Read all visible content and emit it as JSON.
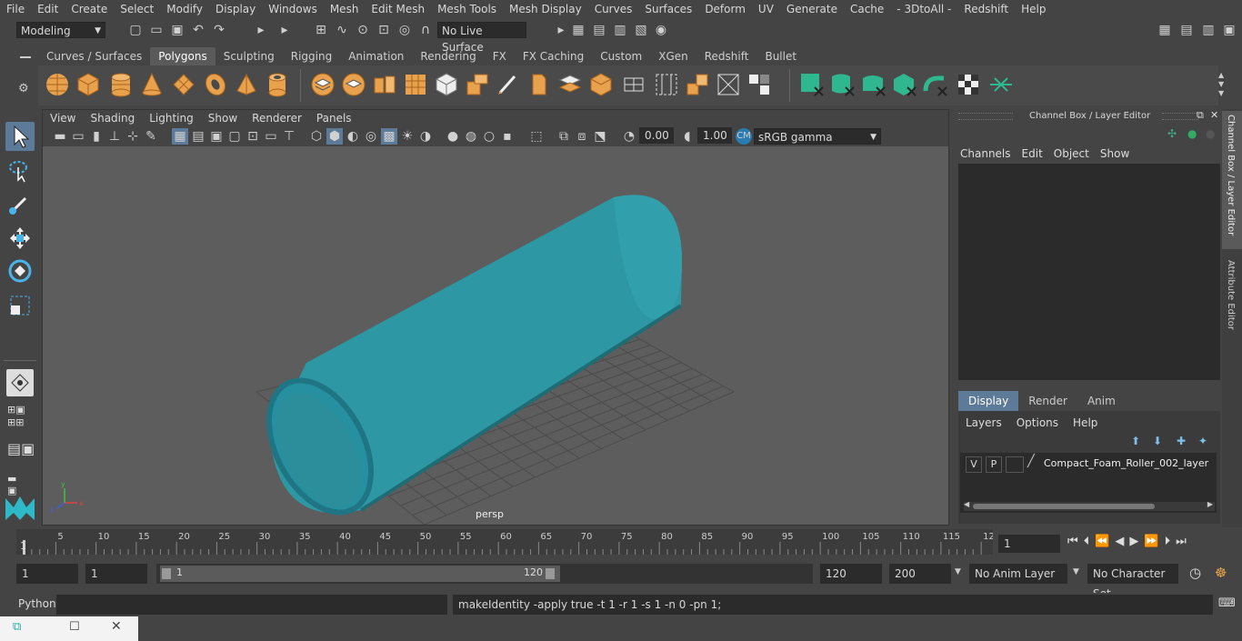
{
  "menubar": [
    "File",
    "Edit",
    "Create",
    "Select",
    "Modify",
    "Display",
    "Windows",
    "Mesh",
    "Edit Mesh",
    "Mesh Tools",
    "Mesh Display",
    "Curves",
    "Surfaces",
    "Deform",
    "UV",
    "Generate",
    "Cache",
    "- 3DtoAll -",
    "Redshift",
    "Help"
  ],
  "status": {
    "mode": "Modeling",
    "live_surface": "No Live Surface"
  },
  "shelf_tabs": [
    "Curves / Surfaces",
    "Polygons",
    "Sculpting",
    "Rigging",
    "Animation",
    "Rendering",
    "FX",
    "FX Caching",
    "Custom",
    "XGen",
    "Redshift",
    "Bullet"
  ],
  "active_shelf_tab": "Polygons",
  "viewport": {
    "menu": [
      "View",
      "Shading",
      "Lighting",
      "Show",
      "Renderer",
      "Panels"
    ],
    "exposure": "0.00",
    "gamma": "1.00",
    "color_space": "sRGB gamma",
    "camera_label": "persp",
    "object_color": "#2f9aa6"
  },
  "channel_box": {
    "title": "Channel Box / Layer Editor",
    "menu": [
      "Channels",
      "Edit",
      "Object",
      "Show"
    ],
    "layer_tabs": [
      "Display",
      "Render",
      "Anim"
    ],
    "active_layer_tab": "Display",
    "layer_menu": [
      "Layers",
      "Options",
      "Help"
    ],
    "layer": {
      "v": "V",
      "p": "P",
      "name": "Compact_Foam_Roller_002_layer"
    }
  },
  "side_tabs": [
    "Channel Box / Layer Editor",
    "Attribute Editor"
  ],
  "time_slider": {
    "ticks": [
      "5",
      "10",
      "15",
      "20",
      "25",
      "30",
      "35",
      "40",
      "45",
      "50",
      "55",
      "60",
      "65",
      "70",
      "75",
      "80",
      "85",
      "90",
      "95",
      "100",
      "105",
      "110",
      "115",
      "12"
    ],
    "start": "1",
    "current_frame": "1"
  },
  "range": {
    "start": "1",
    "playback_start": "1",
    "slider_start": "1",
    "slider_end": "120",
    "end": "120",
    "anim_end": "200",
    "anim_layer": "No Anim Layer",
    "character_set": "No Character Set"
  },
  "command": {
    "lang": "Python",
    "result": "makeIdentity -apply true -t 1 -r 1 -s 1 -n 0 -pn 1;"
  }
}
